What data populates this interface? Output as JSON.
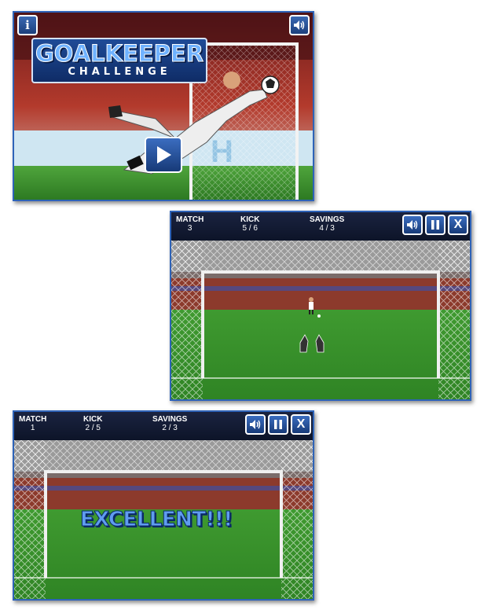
{
  "title_screen": {
    "logo_main": "GOALKEEPER",
    "logo_sub": "CHALLENGE",
    "info_label": "i",
    "sound_icon": "speaker-icon",
    "play_icon": "play-icon"
  },
  "labels": {
    "match": "MATCH",
    "kick": "KICK",
    "savings": "SAVINGS",
    "close": "X"
  },
  "screens": [
    {
      "match": "3",
      "kick": "5 / 6",
      "savings": "4 / 3"
    },
    {
      "match": "1",
      "kick": "2 / 5",
      "savings": "2 / 3",
      "message": "EXCELLENT!!!"
    }
  ],
  "colors": {
    "frame": "#2e63b8",
    "button": "#1f4b97",
    "pitch": "#3a9a2e",
    "hud": "#121a33"
  }
}
